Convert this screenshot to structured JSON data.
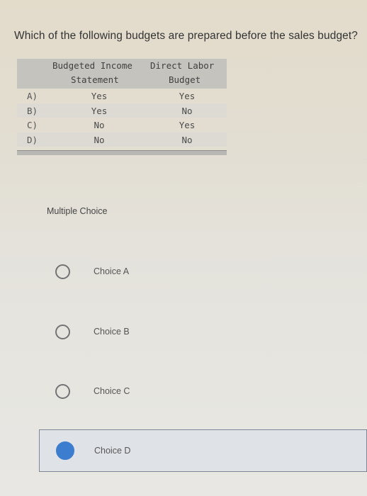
{
  "question": "Which of the following budgets are prepared before the sales budget?",
  "table": {
    "headers": [
      {
        "line1": "Budgeted Income",
        "line2": "Statement"
      },
      {
        "line1": "Direct Labor",
        "line2": "Budget"
      }
    ],
    "rows": [
      {
        "label": "A)",
        "income_statement": "Yes",
        "direct_labor": "Yes"
      },
      {
        "label": "B)",
        "income_statement": "Yes",
        "direct_labor": "No"
      },
      {
        "label": "C)",
        "income_statement": "No",
        "direct_labor": "Yes"
      },
      {
        "label": "D)",
        "income_statement": "No",
        "direct_labor": "No"
      }
    ]
  },
  "multiple_choice": {
    "label": "Multiple Choice",
    "choices": [
      {
        "label": "Choice A",
        "selected": false
      },
      {
        "label": "Choice B",
        "selected": false
      },
      {
        "label": "Choice C",
        "selected": false
      },
      {
        "label": "Choice D",
        "selected": true
      }
    ],
    "selected_color": "#3d7dd0"
  }
}
